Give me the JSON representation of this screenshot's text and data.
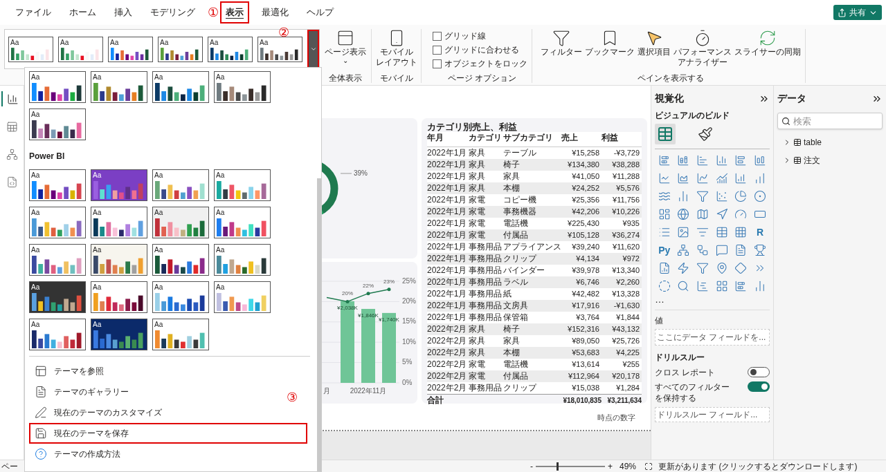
{
  "menu_tabs": [
    {
      "label": "ファイル",
      "selected": false,
      "highlighted": false
    },
    {
      "label": "ホーム",
      "selected": false,
      "highlighted": false
    },
    {
      "label": "挿入",
      "selected": false,
      "highlighted": false
    },
    {
      "label": "モデリング",
      "selected": false,
      "highlighted": false
    },
    {
      "label": "表示",
      "selected": true,
      "highlighted": true
    },
    {
      "label": "最適化",
      "selected": false,
      "highlighted": false
    },
    {
      "label": "ヘルプ",
      "selected": false,
      "highlighted": false
    }
  ],
  "annotations": [
    "①",
    "②",
    "③"
  ],
  "share_button": {
    "label": "共有"
  },
  "ribbon": {
    "gallery": [
      {
        "text": "Aa"
      },
      {
        "text": "Aa"
      },
      {
        "text": "Aa"
      },
      {
        "text": "Aa"
      },
      {
        "text": "Aa"
      },
      {
        "text": "Aa"
      }
    ],
    "gallery_expand": {
      "highlighted": true
    },
    "page_view": {
      "label": "ページ表示",
      "caret": "⌄",
      "group": "全体表示"
    },
    "mobile": {
      "lines": [
        "モバイル",
        "レイアウト"
      ],
      "group": "モバイル"
    },
    "page_options": {
      "group": "ページ オプション",
      "checkboxes": [
        {
          "label": "グリッド線",
          "checked": false
        },
        {
          "label": "グリッドに合わせる",
          "checked": false
        },
        {
          "label": "オブジェクトをロック",
          "checked": false
        }
      ]
    },
    "panes": {
      "group": "ペインを表示する",
      "buttons": [
        {
          "kind": "filter",
          "lines": [
            "フィルター"
          ]
        },
        {
          "kind": "bookmark",
          "lines": [
            "ブックマーク"
          ]
        },
        {
          "kind": "selection",
          "lines": [
            "選択項目"
          ]
        },
        {
          "kind": "performance",
          "lines": [
            "パフォーマンス",
            "アナライザー"
          ]
        },
        {
          "kind": "sync",
          "lines": [
            "スライサーの同期"
          ]
        }
      ]
    }
  },
  "views": [
    {
      "kind": "report",
      "selected": true
    },
    {
      "kind": "table",
      "selected": false
    },
    {
      "kind": "model",
      "selected": false
    },
    {
      "kind": "dax",
      "selected": false
    }
  ],
  "theme_menu": {
    "custom_themes": [
      {
        "text": "Aa"
      },
      {
        "text": "Aa"
      },
      {
        "text": "Aa"
      },
      {
        "text": "Aa"
      },
      {
        "text": "Aa"
      }
    ],
    "section": "Power BI",
    "themes": [
      {
        "text": "Aa"
      },
      {
        "text": "Aa"
      },
      {
        "text": "Aa"
      },
      {
        "text": "Aa"
      },
      {
        "text": "Aa"
      },
      {
        "text": "Aa"
      },
      {
        "text": "Aa"
      },
      {
        "text": "Aa"
      },
      {
        "text": "Aa"
      },
      {
        "text": "Aa"
      },
      {
        "text": "Aa"
      },
      {
        "text": "Aa"
      },
      {
        "text": "Aa"
      },
      {
        "text": "Aa"
      },
      {
        "text": "Aa"
      },
      {
        "text": "Aa"
      },
      {
        "text": "Aa"
      },
      {
        "text": "Aa"
      },
      {
        "text": "Aa"
      }
    ],
    "actions": [
      {
        "kind": "browse",
        "label": "テーマを参照",
        "highlighted": false
      },
      {
        "kind": "gallery",
        "label": "テーマのギャラリー",
        "highlighted": false
      },
      {
        "kind": "customize",
        "label": "現在のテーマのカスタマイズ",
        "highlighted": false
      },
      {
        "kind": "save",
        "label": "現在のテーマを保存",
        "highlighted": true
      },
      {
        "kind": "help",
        "label": "テーマの作成方法",
        "highlighted": false
      }
    ]
  },
  "donut_card": {
    "label": "39%"
  },
  "combo_chart": {
    "chart_data": {
      "type": "bar",
      "categories": [
        "月",
        null,
        "2022年11月",
        null
      ],
      "ylim": [
        0,
        25
      ],
      "grid": true,
      "yticks": [
        {
          "value": 0,
          "label": "0%"
        },
        {
          "value": 5,
          "label": "5%"
        },
        {
          "value": 10,
          "label": "10%"
        },
        {
          "value": 15,
          "label": "15%"
        },
        {
          "value": 20,
          "label": "20%"
        },
        {
          "value": 25,
          "label": "25%"
        }
      ],
      "series": [
        {
          "type": "bar",
          "color": "#6fc597",
          "values": [
            null,
            20.1,
            18.2,
            17.2
          ]
        },
        {
          "type": "line",
          "color": "#1f7a4f",
          "values": [
            21,
            20,
            22,
            23
          ]
        }
      ],
      "value_labels": [
        [
          null,
          "¥2,038K",
          "¥1,846K",
          "¥1,740K"
        ],
        [
          null,
          "20%",
          "22%",
          "23%"
        ]
      ]
    }
  },
  "table": {
    "title": "カテゴリ別売上、利益",
    "columns": [
      "年月",
      "カテゴリ",
      "サブカテゴリ",
      "売上",
      "利益"
    ],
    "rows": [
      [
        "2022年1月",
        "家具",
        "テーブル",
        "¥15,258",
        "-¥3,729"
      ],
      [
        "2022年1月",
        "家具",
        "椅子",
        "¥134,380",
        "¥38,288"
      ],
      [
        "2022年1月",
        "家具",
        "家具",
        "¥41,050",
        "¥11,288"
      ],
      [
        "2022年1月",
        "家具",
        "本棚",
        "¥24,252",
        "¥5,576"
      ],
      [
        "2022年1月",
        "家電",
        "コピー機",
        "¥25,356",
        "¥11,756"
      ],
      [
        "2022年1月",
        "家電",
        "事務機器",
        "¥42,206",
        "¥10,226"
      ],
      [
        "2022年1月",
        "家電",
        "電話機",
        "¥225,430",
        "¥935"
      ],
      [
        "2022年1月",
        "家電",
        "付属品",
        "¥105,128",
        "¥36,274"
      ],
      [
        "2022年1月",
        "事務用品",
        "アプライアンス",
        "¥39,240",
        "¥11,620"
      ],
      [
        "2022年1月",
        "事務用品",
        "クリップ",
        "¥4,134",
        "¥972"
      ],
      [
        "2022年1月",
        "事務用品",
        "バインダー",
        "¥39,978",
        "¥13,340"
      ],
      [
        "2022年1月",
        "事務用品",
        "ラベル",
        "¥6,746",
        "¥2,260"
      ],
      [
        "2022年1月",
        "事務用品",
        "紙",
        "¥42,482",
        "¥13,328"
      ],
      [
        "2022年1月",
        "事務用品",
        "文房具",
        "¥17,916",
        "-¥1,630"
      ],
      [
        "2022年1月",
        "事務用品",
        "保管箱",
        "¥3,764",
        "¥1,844"
      ],
      [
        "2022年2月",
        "家具",
        "椅子",
        "¥152,316",
        "¥43,132"
      ],
      [
        "2022年2月",
        "家具",
        "家具",
        "¥89,050",
        "¥25,726"
      ],
      [
        "2022年2月",
        "家具",
        "本棚",
        "¥53,683",
        "¥4,225"
      ],
      [
        "2022年2月",
        "家電",
        "電話機",
        "¥13,614",
        "¥255"
      ],
      [
        "2022年2月",
        "家電",
        "付属品",
        "¥112,964",
        "¥20,178"
      ],
      [
        "2022年2月",
        "事務用品",
        "クリップ",
        "¥15,038",
        "¥1,284"
      ]
    ],
    "total": {
      "label": "合計",
      "sales": "¥18,010,835",
      "profit": "¥3,211,634"
    }
  },
  "page_note": "時点の数字",
  "visualizations": {
    "title": "視覚化",
    "subtitle": "ビジュアルのビルド",
    "build_tabs": [
      {
        "kind": "fields",
        "selected": true
      },
      {
        "kind": "format",
        "selected": false
      }
    ],
    "types": [
      {
        "kind": "stacked-bar"
      },
      {
        "kind": "stacked-column"
      },
      {
        "kind": "bar"
      },
      {
        "kind": "column"
      },
      {
        "kind": "big-bar"
      },
      {
        "kind": "big-column"
      },
      {
        "kind": "line"
      },
      {
        "kind": "area"
      },
      {
        "kind": "spline"
      },
      {
        "kind": "combo"
      },
      {
        "kind": "rising-column"
      },
      {
        "kind": "rising-bars"
      },
      {
        "kind": "waves"
      },
      {
        "kind": "column-small"
      },
      {
        "kind": "funnel"
      },
      {
        "kind": "scatter"
      },
      {
        "kind": "pie"
      },
      {
        "kind": "donut"
      },
      {
        "kind": "treemap"
      },
      {
        "kind": "globe"
      },
      {
        "kind": "map"
      },
      {
        "kind": "navigation"
      },
      {
        "kind": "gauge"
      },
      {
        "kind": "card"
      },
      {
        "kind": "list"
      },
      {
        "kind": "image"
      },
      {
        "kind": "slicer"
      },
      {
        "kind": "table"
      },
      {
        "kind": "matrix"
      },
      {
        "kind": "text",
        "text": "R"
      },
      {
        "kind": "text",
        "text": "Py"
      },
      {
        "kind": "network"
      },
      {
        "kind": "workflow"
      },
      {
        "kind": "message"
      },
      {
        "kind": "document"
      },
      {
        "kind": "trophy"
      },
      {
        "kind": "file-chart"
      },
      {
        "kind": "zap"
      },
      {
        "kind": "filter"
      },
      {
        "kind": "pin"
      },
      {
        "kind": "diamond"
      },
      {
        "kind": "chevrons"
      },
      {
        "kind": "dashed-circle"
      },
      {
        "kind": "search"
      },
      {
        "kind": "gantt"
      },
      {
        "kind": "grid"
      },
      {
        "kind": "steps"
      },
      {
        "kind": "column-small"
      }
    ],
    "more": "…",
    "values_label": "値",
    "values_placeholder": "ここにデータ フィールドを...",
    "drillthrough": "ドリルスルー",
    "toggles": [
      {
        "lines": [
          "クロス レポート"
        ],
        "on": false
      },
      {
        "lines": [
          "すべてのフィルター",
          "を保持する"
        ],
        "on": true
      }
    ],
    "drill_placeholder": "ドリルスルー フィールド..."
  },
  "data_pane": {
    "title": "データ",
    "search_placeholder": "検索",
    "tables": [
      {
        "label": "table",
        "expanded": false
      },
      {
        "label": "注文",
        "expanded": false
      }
    ]
  },
  "status_bar": {
    "page": "ペー",
    "minus": "-",
    "plus": "+",
    "zoom": "49%",
    "level": 0.3,
    "message": "更新があります (クリックするとダウンロードします)"
  }
}
